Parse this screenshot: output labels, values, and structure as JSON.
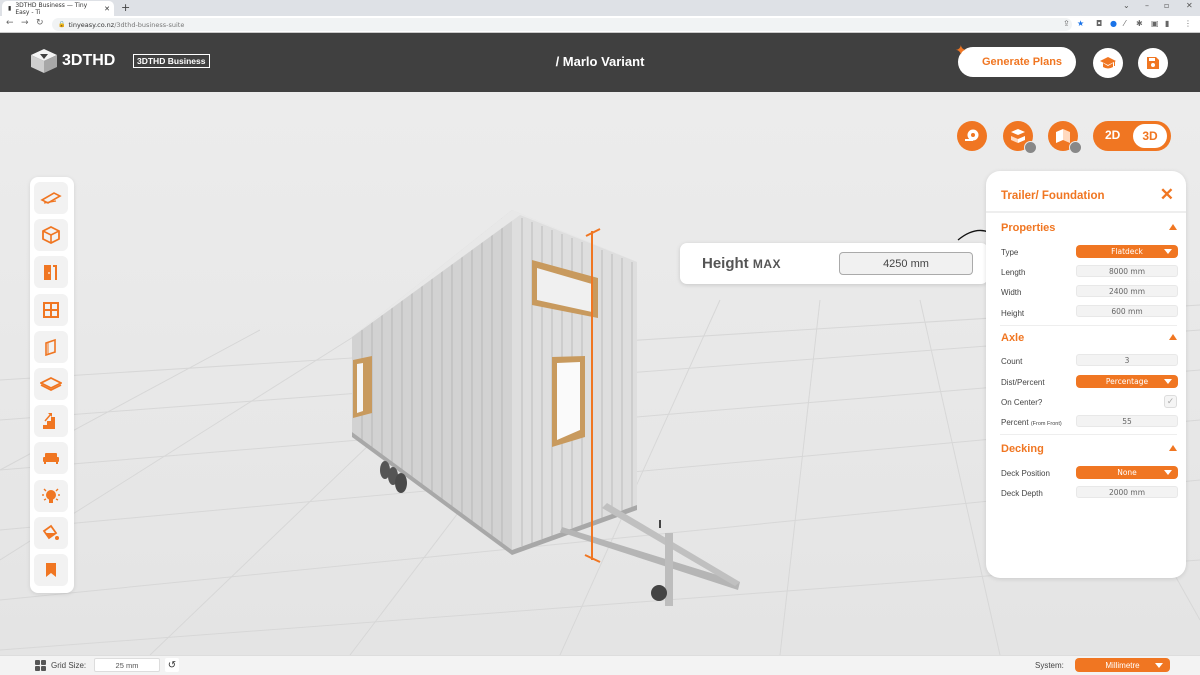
{
  "browser": {
    "tab_title": "3DTHD Business — Tiny Easy - Ti",
    "url_host": "tinyeasy.co.nz",
    "url_path": "/3dthd-business-suite"
  },
  "header": {
    "logo_text": "3DTHD",
    "badge": "3DTHD Business",
    "project_title": "/ Marlo Variant",
    "generate_label": "Generate Plans"
  },
  "view_toggle": {
    "option_2d": "2D",
    "option_3d": "3D",
    "active": "3D"
  },
  "height_popup": {
    "label": "Height",
    "label_suffix": "MAX",
    "value": "4250 mm"
  },
  "panel": {
    "title": "Trailer/ Foundation",
    "sections": {
      "properties": {
        "title": "Properties",
        "type_label": "Type",
        "type_value": "Flatdeck",
        "length_label": "Length",
        "length_value": "8000 mm",
        "width_label": "Width",
        "width_value": "2400 mm",
        "height_label": "Height",
        "height_value": "600 mm"
      },
      "axle": {
        "title": "Axle",
        "count_label": "Count",
        "count_value": "3",
        "dist_label": "Dist/Percent",
        "dist_value": "Percentage",
        "oncenter_label": "On Center?",
        "oncenter_checked": true,
        "percent_label": "Percent",
        "percent_note": "(From Front)",
        "percent_value": "55"
      },
      "decking": {
        "title": "Decking",
        "position_label": "Deck Position",
        "position_value": "None",
        "depth_label": "Deck Depth",
        "depth_value": "2000 mm"
      }
    }
  },
  "bottom_bar": {
    "grid_label": "Grid Size:",
    "grid_value": "25 mm",
    "system_label": "System:",
    "system_value": "Millimetre"
  },
  "toolbar_items": [
    "foundation",
    "walls",
    "doors",
    "windows",
    "cladding",
    "floor",
    "stairs",
    "furniture",
    "lighting",
    "paint",
    "bookmarks"
  ],
  "colors": {
    "accent": "#f07622",
    "header_bg": "#404040"
  }
}
